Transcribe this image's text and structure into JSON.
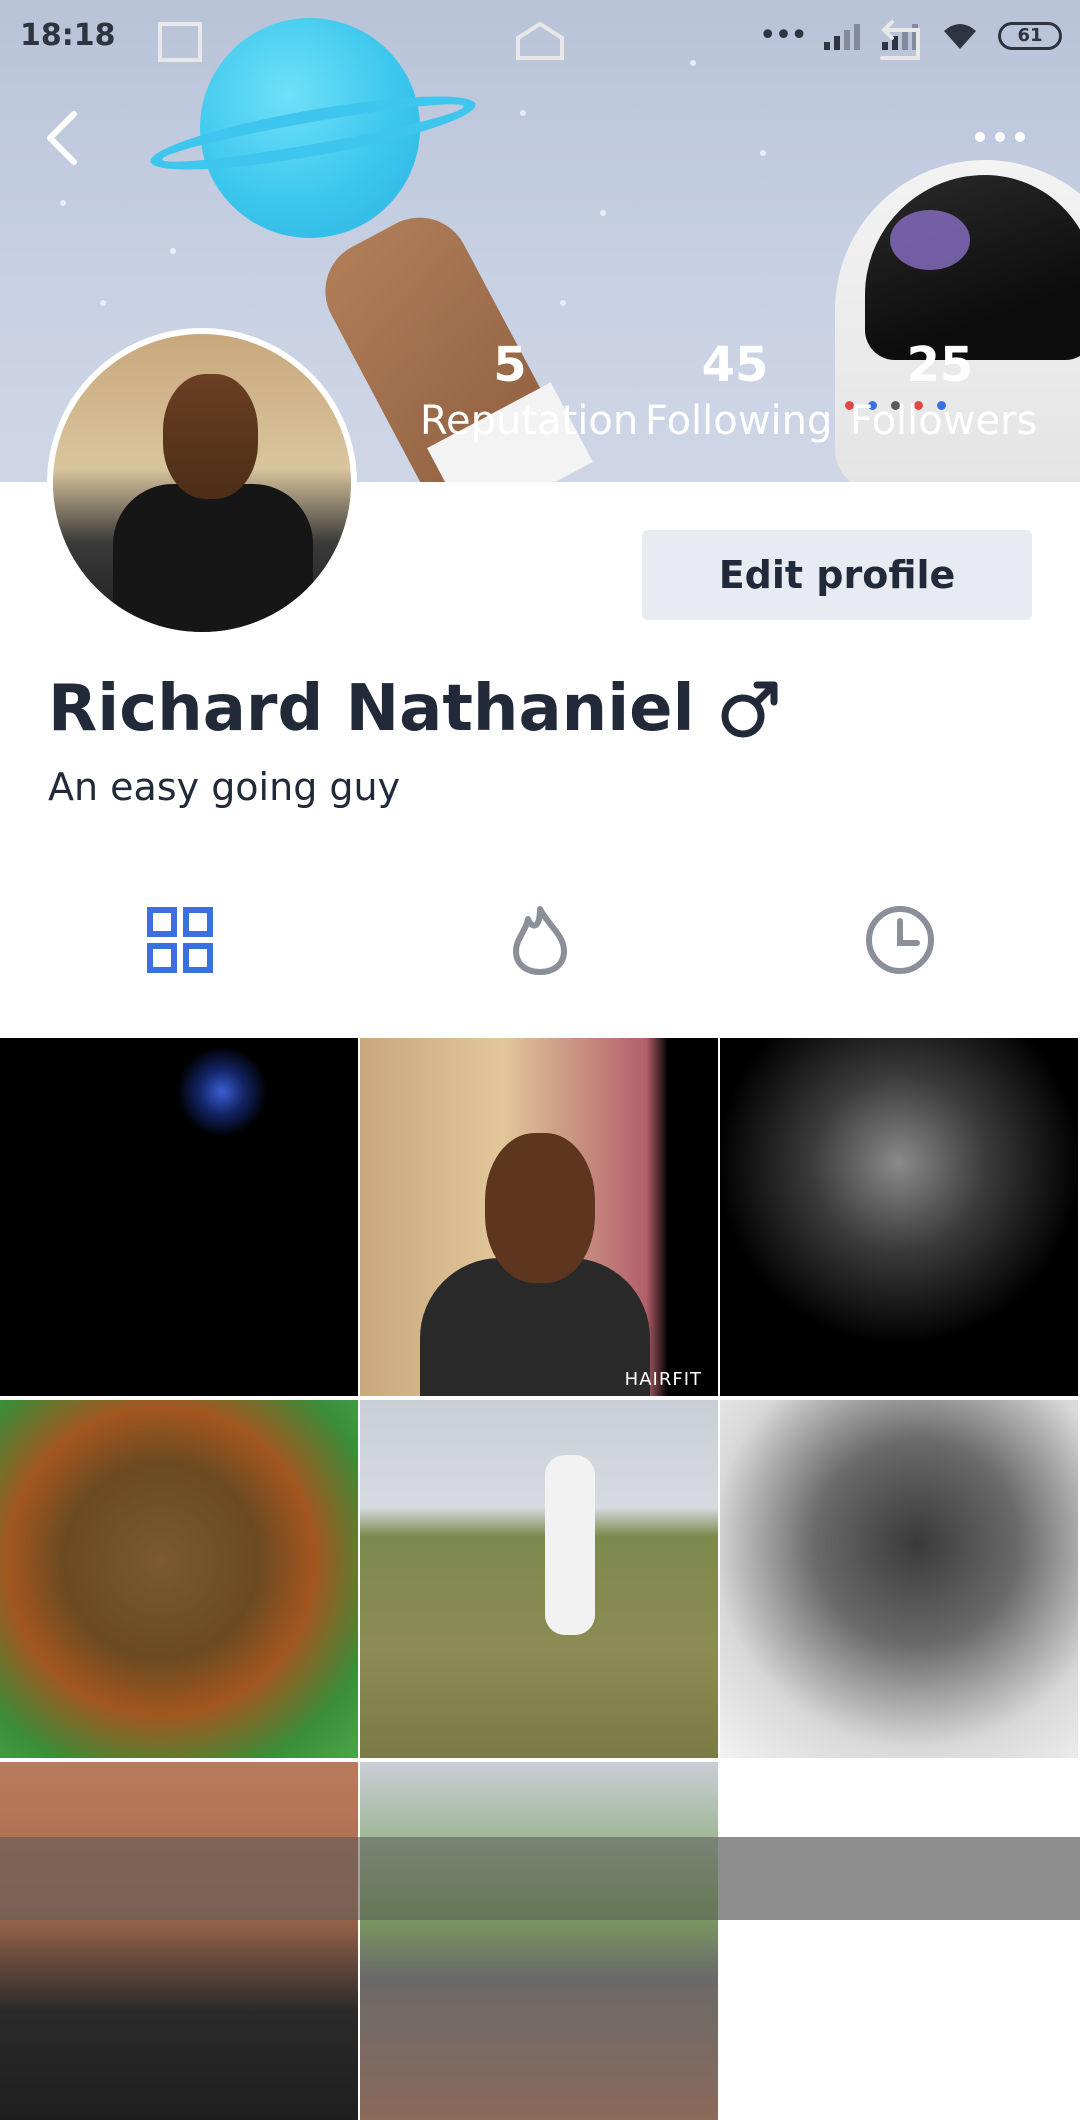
{
  "status_bar": {
    "time": "18:18",
    "battery": "61",
    "icons": [
      "more-dots-icon",
      "signal-icon",
      "signal-icon",
      "wifi-icon",
      "battery-icon"
    ]
  },
  "header": {
    "back_icon": "chevron-left-icon",
    "more_icon": "more-horizontal-icon"
  },
  "stats": [
    {
      "value": "5",
      "label": "Reputation"
    },
    {
      "value": "45",
      "label": "Following"
    },
    {
      "value": "25",
      "label": "Followers"
    }
  ],
  "profile": {
    "name": "Richard Nathaniel",
    "gender_icon": "male-symbol-icon",
    "bio": "An easy going guy",
    "edit_button": "Edit profile"
  },
  "tabs": [
    {
      "icon": "grid-icon",
      "active": true
    },
    {
      "icon": "flame-icon",
      "active": false
    },
    {
      "icon": "clock-icon",
      "active": false
    }
  ],
  "colors": {
    "accent": "#3b6fe0",
    "text": "#222a3a",
    "inactive_icon": "#8a8f98",
    "button_bg": "#e8ebf1"
  },
  "grid": {
    "watermark": "HAIRFIT",
    "tiles": [
      "photo-blue-eye-cat",
      "photo-selfie",
      "photo-black-rose",
      "photo-food",
      "photo-football-field",
      "photo-sketch-portrait",
      "photo-two-boys",
      "photo-outdoor-group"
    ]
  },
  "nav_bar": {
    "icons": [
      "recent-apps-icon",
      "home-icon",
      "back-icon"
    ]
  }
}
